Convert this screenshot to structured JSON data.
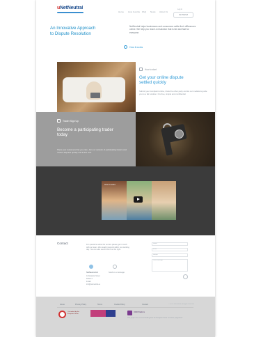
{
  "header": {
    "logo_prefix": "u",
    "logo_text": "NetNeutral",
    "nav": [
      "Home",
      "How it works",
      "FAQ",
      "News",
      "About Us"
    ],
    "sub_label": "Log in",
    "button_label": "Get Started"
  },
  "hero": {
    "title_line1": "An Innovative Approach",
    "title_line2": "to Dispute Resolution",
    "text": "NetNeutral helps businesses and consumers settle their differences online. We help you reach a resolution that is fair and fast for everyone.",
    "link_label": "How it works"
  },
  "section1": {
    "tag": "How to start",
    "title_line1": "Get your online dispute",
    "title_line2": "settled quickly",
    "text": "Submit your complaint online, invite the other party and let our mediators guide you to a fair solution. It is free, simple and confidential."
  },
  "section2": {
    "tag": "Trader Sign Up",
    "title_line1": "Become a participating trader",
    "title_line2": "today",
    "text": "Show your customers that you care. Join our network of participating traders and resolve disputes quickly and at low cost."
  },
  "video": {
    "label": "How it works"
  },
  "contact": {
    "title": "Contact",
    "text": "For questions about the service please get in touch with our team. We usually respond within one working day. You can also use the form on the right.",
    "option1": "NetNeutral Ltd",
    "option2": "Send us a message",
    "address": [
      "12 Example Street",
      "Dublin 2",
      "Ireland",
      "info@netneutral.eu"
    ],
    "fields": [
      "Name",
      "Email",
      "Subject"
    ],
    "message_placeholder": "Your message"
  },
  "footer": {
    "nav": [
      "Home",
      "Privacy Policy",
      "Terms",
      "Cookie Policy",
      "Contact"
    ],
    "meta": "© 2015 NetNeutral. All rights reserved.",
    "eu_text": "Co-funded by the European Union",
    "logo3_text": "ODR Platform",
    "text": "This project has received funding from the European Union consumer programme."
  },
  "colors": {
    "accent": "#2e9ad6",
    "band_grey": "#9d9d9d",
    "band_dark": "#3b3b3b",
    "footer_bg": "#d7d7d7"
  }
}
